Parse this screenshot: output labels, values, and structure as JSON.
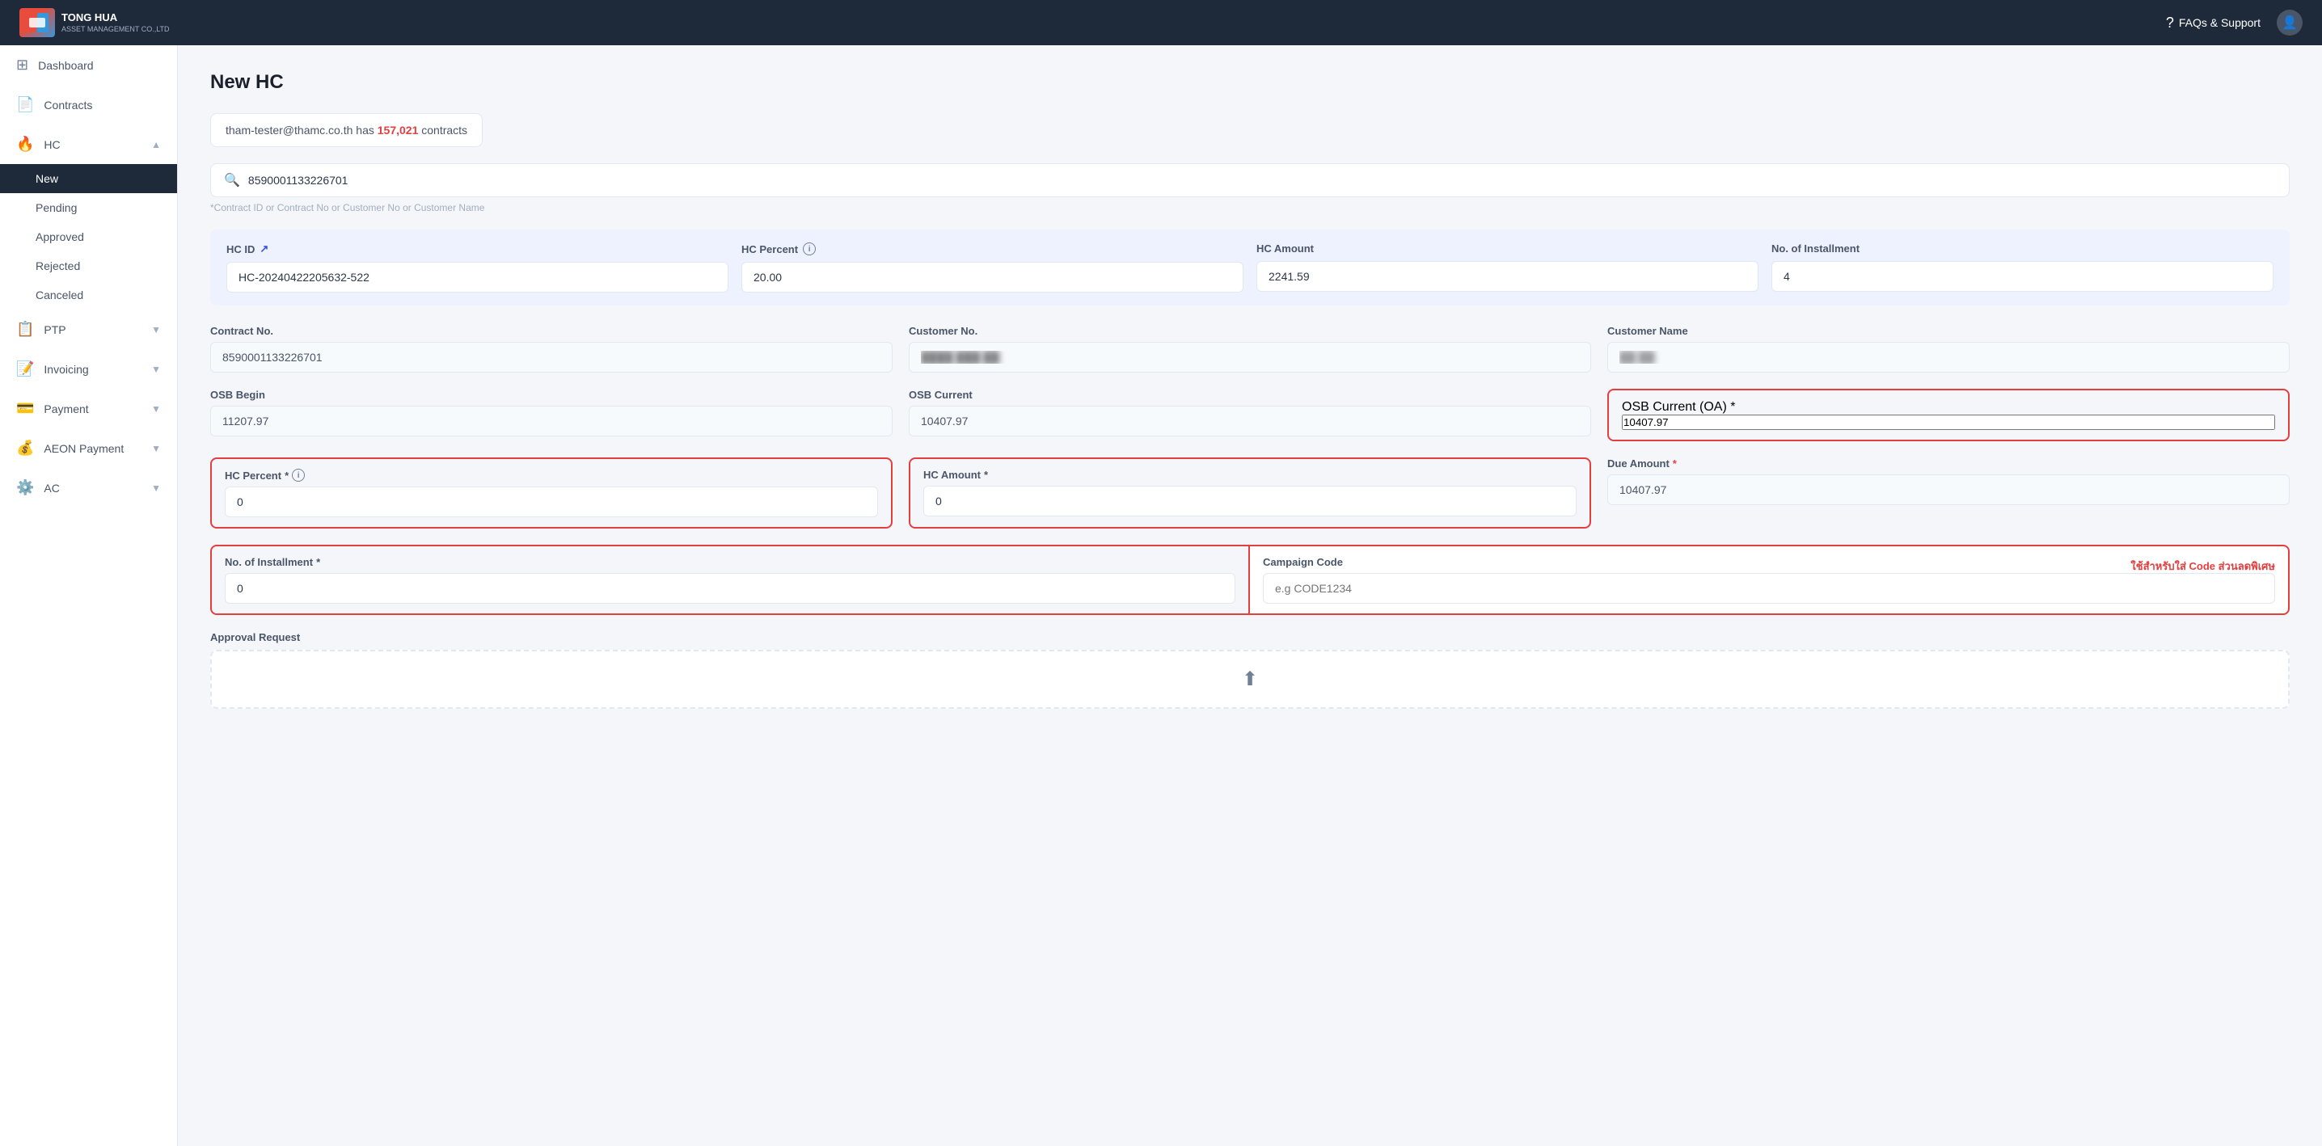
{
  "navbar": {
    "logo_text_line1": "TONG HUA",
    "logo_text_line2": "ASSET MANAGEMENT CO.,LTD",
    "faq_label": "FAQs & Support"
  },
  "sidebar": {
    "items": [
      {
        "id": "dashboard",
        "label": "Dashboard",
        "icon": "⊞",
        "active": false
      },
      {
        "id": "contracts",
        "label": "Contracts",
        "icon": "📄",
        "active": false
      },
      {
        "id": "hc",
        "label": "HC",
        "icon": "🔥",
        "active": true,
        "expanded": true
      },
      {
        "id": "ptp",
        "label": "PTP",
        "icon": "📋",
        "active": false
      },
      {
        "id": "invoicing",
        "label": "Invoicing",
        "icon": "📝",
        "active": false
      },
      {
        "id": "payment",
        "label": "Payment",
        "icon": "💳",
        "active": false
      },
      {
        "id": "aeon_payment",
        "label": "AEON Payment",
        "icon": "💰",
        "active": false
      },
      {
        "id": "ac",
        "label": "AC",
        "icon": "⚙️",
        "active": false
      }
    ],
    "hc_sub_items": [
      {
        "id": "new",
        "label": "New",
        "active": true
      },
      {
        "id": "pending",
        "label": "Pending",
        "active": false
      },
      {
        "id": "approved",
        "label": "Approved",
        "active": false
      },
      {
        "id": "rejected",
        "label": "Rejected",
        "active": false
      },
      {
        "id": "canceled",
        "label": "Canceled",
        "active": false
      }
    ]
  },
  "page": {
    "title": "New HC",
    "info_banner": {
      "email": "tham-tester@thamc.co.th",
      "has_text": "has",
      "count": "157,021",
      "contracts_text": "contracts"
    },
    "search": {
      "value": "8590001133226701",
      "placeholder": "*Contract ID or Contract No or Customer No or Customer Name",
      "hint": "*Contract ID or Contract No or Customer No or Customer Name"
    },
    "hc_table": {
      "hc_id_label": "HC ID",
      "hc_id_value": "HC-20240422205632-522",
      "hc_percent_label": "HC Percent",
      "hc_percent_value": "20.00",
      "hc_amount_label": "HC Amount",
      "hc_amount_value": "2241.59",
      "no_installment_label": "No. of Installment",
      "no_installment_value": "4"
    },
    "form": {
      "contract_no_label": "Contract No.",
      "contract_no_value": "8590001133226701",
      "customer_no_label": "Customer No.",
      "customer_no_value": "████ ███ ██",
      "customer_name_label": "Customer Name",
      "customer_name_value": "██ ██",
      "osb_begin_label": "OSB Begin",
      "osb_begin_value": "11207.97",
      "osb_current_label": "OSB Current",
      "osb_current_value": "10407.97",
      "osb_current_oa_label": "OSB Current (OA)",
      "osb_current_oa_value": "10407.97",
      "required_star": "*",
      "hc_percent_label": "HC Percent",
      "hc_percent_value": "0",
      "hc_amount_label": "HC Amount",
      "hc_amount_value": "0",
      "due_amount_label": "Due Amount",
      "due_amount_value": "10407.97",
      "no_installment_label": "No. of Installment",
      "no_installment_value": "0",
      "campaign_code_label": "Campaign Code",
      "campaign_code_placeholder": "e.g CODE1234",
      "campaign_tooltip": "ใช้สำหรับใส่ Code ส่วนลดพิเศษ",
      "approval_request_label": "Approval Request",
      "upload_icon": "⬆"
    }
  }
}
